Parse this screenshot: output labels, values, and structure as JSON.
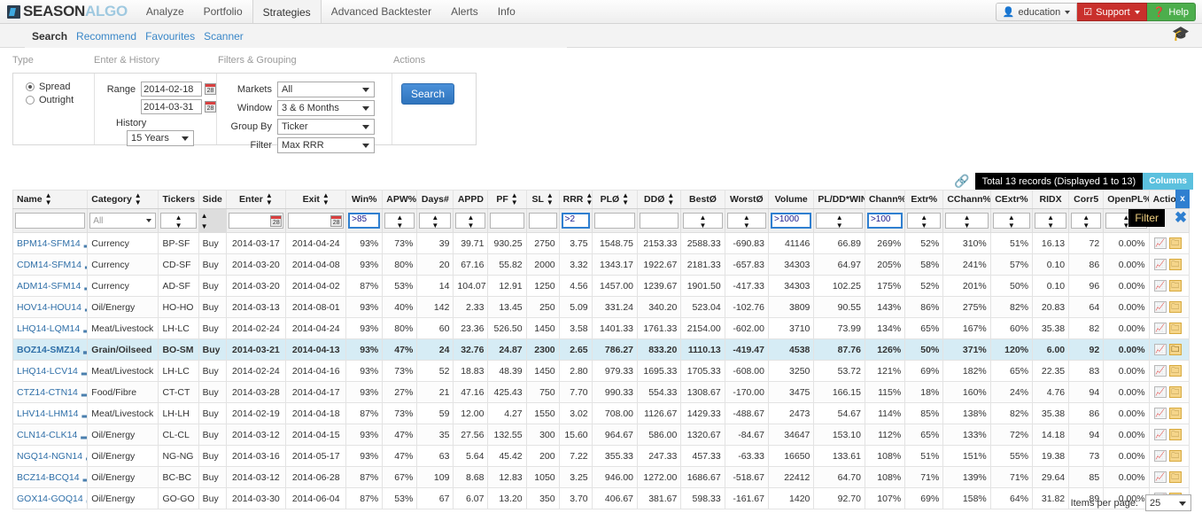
{
  "brand": {
    "season": "SEASON",
    "algo": "ALGO"
  },
  "nav": {
    "items": [
      {
        "label": "Analyze"
      },
      {
        "label": "Portfolio"
      },
      {
        "label": "Strategies"
      },
      {
        "label": "Advanced Backtester"
      },
      {
        "label": "Alerts"
      },
      {
        "label": "Info"
      }
    ],
    "user_label": "education",
    "support_label": "Support",
    "help_label": "Help",
    "user_icon": "person-icon",
    "support_icon": "checkbox-icon",
    "help_icon": "question-circle-icon",
    "graduation_icon": "graduation-cap-icon"
  },
  "subnav": {
    "items": [
      {
        "label": "Search",
        "current": true
      },
      {
        "label": "Recommend",
        "current": false
      },
      {
        "label": "Favourites",
        "current": false
      },
      {
        "label": "Scanner",
        "current": false
      }
    ]
  },
  "panel": {
    "headers": {
      "type": "Type",
      "enter_history": "Enter & History",
      "filters_grouping": "Filters & Grouping",
      "actions": "Actions"
    },
    "type": {
      "spread_label": "Spread",
      "outright_label": "Outright",
      "selected": "Spread"
    },
    "enter": {
      "range_label": "Range",
      "date_from": "2014-02-18",
      "date_to": "2014-03-31",
      "history_label": "History",
      "history_value": "15 Years",
      "calendar_icon": "calendar-icon",
      "calendar_day": "28"
    },
    "filters": {
      "markets_label": "Markets",
      "markets_value": "All",
      "window_label": "Window",
      "window_value": "3 & 6 Months",
      "groupby_label": "Group By",
      "groupby_value": "Ticker",
      "filter_label": "Filter",
      "filter_value": "Max RRR"
    },
    "actions": {
      "search_label": "Search"
    }
  },
  "records": {
    "link_icon": "link-icon",
    "text": "Total 13 records (Displayed 1 to 13)",
    "columns_label": "Columns"
  },
  "table": {
    "x_badge": "x",
    "filter_tag": "Filter",
    "close_icon": "✖",
    "columns": [
      {
        "key": "name",
        "label": "Name",
        "sortable": true,
        "align": "left"
      },
      {
        "key": "category",
        "label": "Category",
        "sortable": true,
        "align": "left"
      },
      {
        "key": "tickers",
        "label": "Tickers",
        "sortable": false,
        "align": "left"
      },
      {
        "key": "side",
        "label": "Side",
        "sortable": false,
        "align": "left"
      },
      {
        "key": "enter",
        "label": "Enter",
        "sortable": true,
        "align": "center"
      },
      {
        "key": "exit",
        "label": "Exit",
        "sortable": true,
        "align": "center"
      },
      {
        "key": "win",
        "label": "Win%",
        "sortable": false,
        "align": "right"
      },
      {
        "key": "apw",
        "label": "APW%",
        "sortable": false,
        "align": "right"
      },
      {
        "key": "days",
        "label": "Days#",
        "sortable": false,
        "align": "right"
      },
      {
        "key": "appd",
        "label": "APPD",
        "sortable": false,
        "align": "right"
      },
      {
        "key": "pf",
        "label": "PF",
        "sortable": true,
        "align": "right"
      },
      {
        "key": "sl",
        "label": "SL",
        "sortable": true,
        "align": "right"
      },
      {
        "key": "rrr",
        "label": "RRR",
        "sortable": true,
        "align": "right"
      },
      {
        "key": "plo",
        "label": "PLØ",
        "sortable": true,
        "align": "right"
      },
      {
        "key": "ddo",
        "label": "DDØ",
        "sortable": true,
        "align": "right"
      },
      {
        "key": "besto",
        "label": "BestØ",
        "sortable": false,
        "align": "right"
      },
      {
        "key": "worsto",
        "label": "WorstØ",
        "sortable": false,
        "align": "right"
      },
      {
        "key": "volume",
        "label": "Volume",
        "sortable": false,
        "align": "right"
      },
      {
        "key": "plddwin",
        "label": "PL/DD*WIN",
        "sortable": false,
        "align": "right"
      },
      {
        "key": "chann",
        "label": "Chann%",
        "sortable": false,
        "align": "right"
      },
      {
        "key": "extr",
        "label": "Extr%",
        "sortable": false,
        "align": "right"
      },
      {
        "key": "cchann",
        "label": "CChann%",
        "sortable": false,
        "align": "right"
      },
      {
        "key": "cextr",
        "label": "CExtr%",
        "sortable": false,
        "align": "right"
      },
      {
        "key": "ridx",
        "label": "RIDX",
        "sortable": false,
        "align": "right"
      },
      {
        "key": "corr5",
        "label": "Corr5",
        "sortable": false,
        "align": "right"
      },
      {
        "key": "openpl",
        "label": "OpenPL%",
        "sortable": false,
        "align": "right"
      },
      {
        "key": "actions",
        "label": "Actions",
        "sortable": false,
        "align": "center"
      }
    ],
    "filter_row": {
      "name": "",
      "category": "All",
      "win": ">85",
      "rrr": ">2",
      "volume": ">1000",
      "chann": ">100"
    },
    "rows": [
      {
        "name": "BPM14-SFM14",
        "category": "Currency",
        "tickers": "BP-SF",
        "side": "Buy",
        "enter": "2014-03-17",
        "exit": "2014-04-24",
        "win": "93%",
        "apw": "73%",
        "days": "39",
        "appd": "39.71",
        "pf": "930.25",
        "sl": "2750",
        "rrr": "3.75",
        "plo": "1548.75",
        "ddo": "2153.33",
        "besto": "2588.33",
        "worsto": "-690.83",
        "volume": "41146",
        "plddwin": "66.89",
        "chann": "269%",
        "extr": "52%",
        "cchann": "310%",
        "cextr": "51%",
        "ridx": "16.13",
        "corr5": "72",
        "openpl": "0.00%",
        "highlight": false
      },
      {
        "name": "CDM14-SFM14",
        "category": "Currency",
        "tickers": "CD-SF",
        "side": "Buy",
        "enter": "2014-03-20",
        "exit": "2014-04-08",
        "win": "93%",
        "apw": "80%",
        "days": "20",
        "appd": "67.16",
        "pf": "55.82",
        "sl": "2000",
        "rrr": "3.32",
        "plo": "1343.17",
        "ddo": "1922.67",
        "besto": "2181.33",
        "worsto": "-657.83",
        "volume": "34303",
        "plddwin": "64.97",
        "chann": "205%",
        "extr": "58%",
        "cchann": "241%",
        "cextr": "57%",
        "ridx": "0.10",
        "corr5": "86",
        "openpl": "0.00%",
        "highlight": false
      },
      {
        "name": "ADM14-SFM14",
        "category": "Currency",
        "tickers": "AD-SF",
        "side": "Buy",
        "enter": "2014-03-20",
        "exit": "2014-04-02",
        "win": "87%",
        "apw": "53%",
        "days": "14",
        "appd": "104.07",
        "pf": "12.91",
        "sl": "1250",
        "rrr": "4.56",
        "plo": "1457.00",
        "ddo": "1239.67",
        "besto": "1901.50",
        "worsto": "-417.33",
        "volume": "34303",
        "plddwin": "102.25",
        "chann": "175%",
        "extr": "52%",
        "cchann": "201%",
        "cextr": "50%",
        "ridx": "0.10",
        "corr5": "96",
        "openpl": "0.00%",
        "highlight": false
      },
      {
        "name": "HOV14-HOU14",
        "category": "Oil/Energy",
        "tickers": "HO-HO",
        "side": "Buy",
        "enter": "2014-03-13",
        "exit": "2014-08-01",
        "win": "93%",
        "apw": "40%",
        "days": "142",
        "appd": "2.33",
        "pf": "13.45",
        "sl": "250",
        "rrr": "5.09",
        "plo": "331.24",
        "ddo": "340.20",
        "besto": "523.04",
        "worsto": "-102.76",
        "volume": "3809",
        "plddwin": "90.55",
        "chann": "143%",
        "extr": "86%",
        "cchann": "275%",
        "cextr": "82%",
        "ridx": "20.83",
        "corr5": "64",
        "openpl": "0.00%",
        "highlight": false
      },
      {
        "name": "LHQ14-LQM14",
        "category": "Meat/Livestock",
        "tickers": "LH-LC",
        "side": "Buy",
        "enter": "2014-02-24",
        "exit": "2014-04-24",
        "win": "93%",
        "apw": "80%",
        "days": "60",
        "appd": "23.36",
        "pf": "526.50",
        "sl": "1450",
        "rrr": "3.58",
        "plo": "1401.33",
        "ddo": "1761.33",
        "besto": "2154.00",
        "worsto": "-602.00",
        "volume": "3710",
        "plddwin": "73.99",
        "chann": "134%",
        "extr": "65%",
        "cchann": "167%",
        "cextr": "60%",
        "ridx": "35.38",
        "corr5": "82",
        "openpl": "0.00%",
        "highlight": false
      },
      {
        "name": "BOZ14-SMZ14",
        "category": "Grain/Oilseed",
        "tickers": "BO-SM",
        "side": "Buy",
        "enter": "2014-03-21",
        "exit": "2014-04-13",
        "win": "93%",
        "apw": "47%",
        "days": "24",
        "appd": "32.76",
        "pf": "24.87",
        "sl": "2300",
        "rrr": "2.65",
        "plo": "786.27",
        "ddo": "833.20",
        "besto": "1110.13",
        "worsto": "-419.47",
        "volume": "4538",
        "plddwin": "87.76",
        "chann": "126%",
        "extr": "50%",
        "cchann": "371%",
        "cextr": "120%",
        "ridx": "6.00",
        "corr5": "92",
        "openpl": "0.00%",
        "highlight": true
      },
      {
        "name": "LHQ14-LCV14",
        "category": "Meat/Livestock",
        "tickers": "LH-LC",
        "side": "Buy",
        "enter": "2014-02-24",
        "exit": "2014-04-16",
        "win": "93%",
        "apw": "73%",
        "days": "52",
        "appd": "18.83",
        "pf": "48.39",
        "sl": "1450",
        "rrr": "2.80",
        "plo": "979.33",
        "ddo": "1695.33",
        "besto": "1705.33",
        "worsto": "-608.00",
        "volume": "3250",
        "plddwin": "53.72",
        "chann": "121%",
        "extr": "69%",
        "cchann": "182%",
        "cextr": "65%",
        "ridx": "22.35",
        "corr5": "83",
        "openpl": "0.00%",
        "highlight": false
      },
      {
        "name": "CTZ14-CTN14",
        "category": "Food/Fibre",
        "tickers": "CT-CT",
        "side": "Buy",
        "enter": "2014-03-28",
        "exit": "2014-04-17",
        "win": "93%",
        "apw": "27%",
        "days": "21",
        "appd": "47.16",
        "pf": "425.43",
        "sl": "750",
        "rrr": "7.70",
        "plo": "990.33",
        "ddo": "554.33",
        "besto": "1308.67",
        "worsto": "-170.00",
        "volume": "3475",
        "plddwin": "166.15",
        "chann": "115%",
        "extr": "18%",
        "cchann": "160%",
        "cextr": "24%",
        "ridx": "4.76",
        "corr5": "94",
        "openpl": "0.00%",
        "highlight": false
      },
      {
        "name": "LHV14-LHM14",
        "category": "Meat/Livestock",
        "tickers": "LH-LH",
        "side": "Buy",
        "enter": "2014-02-19",
        "exit": "2014-04-18",
        "win": "87%",
        "apw": "73%",
        "days": "59",
        "appd": "12.00",
        "pf": "4.27",
        "sl": "1550",
        "rrr": "3.02",
        "plo": "708.00",
        "ddo": "1126.67",
        "besto": "1429.33",
        "worsto": "-488.67",
        "volume": "2473",
        "plddwin": "54.67",
        "chann": "114%",
        "extr": "85%",
        "cchann": "138%",
        "cextr": "82%",
        "ridx": "35.38",
        "corr5": "86",
        "openpl": "0.00%",
        "highlight": false
      },
      {
        "name": "CLN14-CLK14",
        "category": "Oil/Energy",
        "tickers": "CL-CL",
        "side": "Buy",
        "enter": "2014-03-12",
        "exit": "2014-04-15",
        "win": "93%",
        "apw": "47%",
        "days": "35",
        "appd": "27.56",
        "pf": "132.55",
        "sl": "300",
        "rrr": "15.60",
        "plo": "964.67",
        "ddo": "586.00",
        "besto": "1320.67",
        "worsto": "-84.67",
        "volume": "34647",
        "plddwin": "153.10",
        "chann": "112%",
        "extr": "65%",
        "cchann": "133%",
        "cextr": "72%",
        "ridx": "14.18",
        "corr5": "94",
        "openpl": "0.00%",
        "highlight": false
      },
      {
        "name": "NGQ14-NGN14",
        "category": "Oil/Energy",
        "tickers": "NG-NG",
        "side": "Buy",
        "enter": "2014-03-16",
        "exit": "2014-05-17",
        "win": "93%",
        "apw": "47%",
        "days": "63",
        "appd": "5.64",
        "pf": "45.42",
        "sl": "200",
        "rrr": "7.22",
        "plo": "355.33",
        "ddo": "247.33",
        "besto": "457.33",
        "worsto": "-63.33",
        "volume": "16650",
        "plddwin": "133.61",
        "chann": "108%",
        "extr": "51%",
        "cchann": "151%",
        "cextr": "55%",
        "ridx": "19.38",
        "corr5": "73",
        "openpl": "0.00%",
        "highlight": false
      },
      {
        "name": "BCZ14-BCQ14",
        "category": "Oil/Energy",
        "tickers": "BC-BC",
        "side": "Buy",
        "enter": "2014-03-12",
        "exit": "2014-06-28",
        "win": "87%",
        "apw": "67%",
        "days": "109",
        "appd": "8.68",
        "pf": "12.83",
        "sl": "1050",
        "rrr": "3.25",
        "plo": "946.00",
        "ddo": "1272.00",
        "besto": "1686.67",
        "worsto": "-518.67",
        "volume": "22412",
        "plddwin": "64.70",
        "chann": "108%",
        "extr": "71%",
        "cchann": "139%",
        "cextr": "71%",
        "ridx": "29.64",
        "corr5": "85",
        "openpl": "0.00%",
        "highlight": false
      },
      {
        "name": "GOX14-GOQ14",
        "category": "Oil/Energy",
        "tickers": "GO-GO",
        "side": "Buy",
        "enter": "2014-03-30",
        "exit": "2014-06-04",
        "win": "87%",
        "apw": "53%",
        "days": "67",
        "appd": "6.07",
        "pf": "13.20",
        "sl": "350",
        "rrr": "3.70",
        "plo": "406.67",
        "ddo": "381.67",
        "besto": "598.33",
        "worsto": "-161.67",
        "volume": "1420",
        "plddwin": "92.70",
        "chann": "107%",
        "extr": "69%",
        "cchann": "158%",
        "cextr": "64%",
        "ridx": "31.82",
        "corr5": "89",
        "openpl": "0.00%",
        "highlight": false
      }
    ],
    "row_action_icons": [
      "chart-icon",
      "folder-icon"
    ]
  },
  "footer": {
    "items_per_page_label": "Items per page:",
    "items_per_page_value": "25"
  }
}
